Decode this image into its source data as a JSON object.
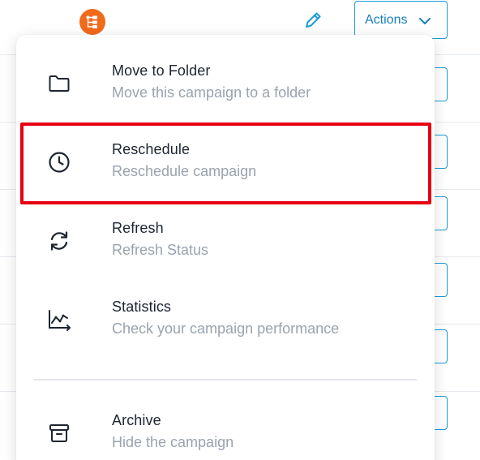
{
  "header": {
    "actions_label": "Actions"
  },
  "icons": {
    "flow": "flow-chart-icon",
    "edit": "pencil-icon",
    "chevron": "chevron-down-icon"
  },
  "colors": {
    "accent": "#1a9bd7",
    "flow_badge": "#f26a1b",
    "highlight": "#e60012"
  },
  "menu": {
    "items": [
      {
        "title": "Move to Folder",
        "subtitle": "Move this campaign to a folder",
        "icon": "folder-icon"
      },
      {
        "title": "Reschedule",
        "subtitle": "Reschedule campaign",
        "icon": "clock-icon"
      },
      {
        "title": "Refresh",
        "subtitle": "Refresh Status",
        "icon": "refresh-icon"
      },
      {
        "title": "Statistics",
        "subtitle": "Check your campaign performance",
        "icon": "chart-icon"
      },
      {
        "title": "Archive",
        "subtitle": "Hide the campaign",
        "icon": "archive-icon"
      }
    ]
  }
}
